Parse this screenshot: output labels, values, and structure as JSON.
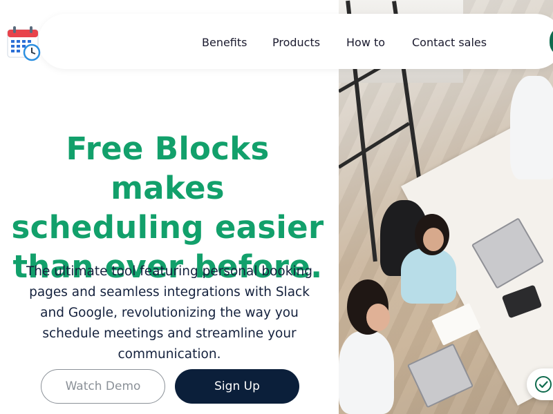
{
  "nav": {
    "links": [
      "Benefits",
      "Products",
      "How to",
      "Contact sales"
    ],
    "logo_icon": "calendar-clock-icon"
  },
  "hero": {
    "title": "Free Blocks makes scheduling easier than ever before.",
    "subtitle": "The ultimate tool featuring personal booking pages and seamless integrations with Slack and Google, revolutionizing the way you schedule meetings and streamline your communication."
  },
  "buttons": {
    "watch_demo": "Watch Demo",
    "sign_up": "Sign Up"
  },
  "badge_icon": "check-circle-icon",
  "colors": {
    "accent_green": "#12a06b",
    "dark_navy": "#0b1f3a",
    "text_dark": "#14213d",
    "badge_green": "#0e6b4d"
  }
}
